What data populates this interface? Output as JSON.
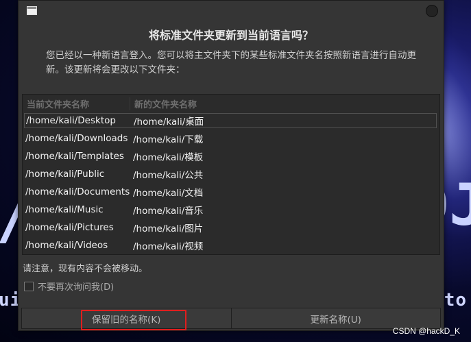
{
  "background": {
    "left_big": "/",
    "left_small": "ui",
    "right_big": "DJ",
    "right_small": "to"
  },
  "watermark": "CSDN @hackD_K",
  "dialog": {
    "title": "将标准文件夹更新到当前语言吗？",
    "description": "您已经以一种新语言登入。您可以将主文件夹下的某些标准文件夹名按照新语言进行自动更新。该更新将会更改以下文件夹：",
    "columns": [
      "当前文件夹名称",
      "新的文件夹名称"
    ],
    "rows": [
      {
        "current": "/home/kali/Desktop",
        "new": "/home/kali/桌面"
      },
      {
        "current": "/home/kali/Downloads",
        "new": "/home/kali/下载"
      },
      {
        "current": "/home/kali/Templates",
        "new": "/home/kali/模板"
      },
      {
        "current": "/home/kali/Public",
        "new": "/home/kali/公共"
      },
      {
        "current": "/home/kali/Documents",
        "new": "/home/kali/文档"
      },
      {
        "current": "/home/kali/Music",
        "new": "/home/kali/音乐"
      },
      {
        "current": "/home/kali/Pictures",
        "new": "/home/kali/图片"
      },
      {
        "current": "/home/kali/Videos",
        "new": "/home/kali/视频"
      }
    ],
    "note": "请注意，现有内容不会被移动。",
    "checkbox_label": "不要再次询问我(D)",
    "checkbox_checked": false,
    "keep_button": "保留旧的名称(K)",
    "update_button": "更新名称(U)",
    "highlight_color": "#e01e1e"
  }
}
